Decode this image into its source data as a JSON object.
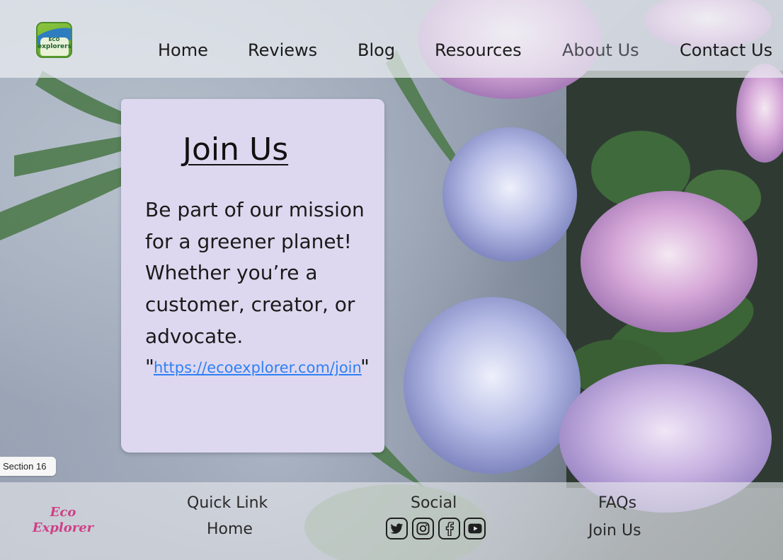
{
  "header": {
    "logo_text_top": "ECO",
    "logo_text_bottom": "explorers",
    "nav": [
      {
        "label": "Home"
      },
      {
        "label": "Reviews"
      },
      {
        "label": "Blog"
      },
      {
        "label": "Resources"
      },
      {
        "label": "About Us"
      },
      {
        "label": "Contact Us"
      }
    ]
  },
  "join": {
    "title": "Join Us",
    "body": "Be part of our mission for a greener planet! Whether you’re a customer, creator, or advocate.",
    "quote_open": "\"",
    "link": "https://ecoexplorer.com/join",
    "quote_close": "\""
  },
  "section_label": "Section 16",
  "footer": {
    "brand_line1": "Eco",
    "brand_line2": "Explorer",
    "quick_link_heading": "Quick Link",
    "quick_link_home": "Home",
    "social_heading": "Social",
    "social_icons": [
      "twitter-icon",
      "instagram-icon",
      "facebook-icon",
      "youtube-icon"
    ],
    "faqs": "FAQs",
    "join_us": "Join Us"
  },
  "colors": {
    "brand_pink": "#cf3f86",
    "link_blue": "#2f7ff5",
    "card_lavender": "#ddd8ef"
  }
}
